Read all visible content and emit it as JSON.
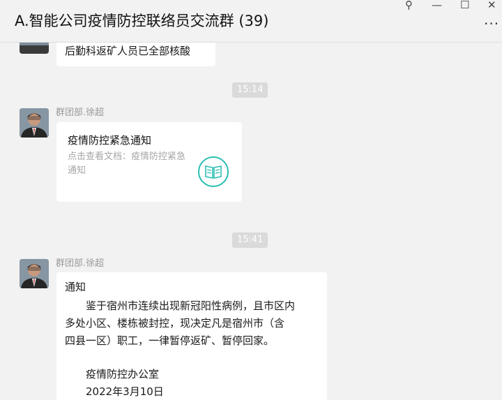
{
  "window": {
    "title": "A.智能公司疫情防控联络员交流群 (39)",
    "pin_glyph": "⚲",
    "minimize_glyph": "—",
    "maximize_glyph": "☐",
    "close_glyph": "✕",
    "more_glyph": "···"
  },
  "messages": {
    "first_bubble": "后勤科返矿人员已全部核酸",
    "time_1": "15:14",
    "sender_1": "群团部.徐超",
    "card": {
      "title": "疫情防控紧急通知",
      "subtitle": "点击查看文档：疫情防控紧急通知"
    },
    "time_2": "15:41",
    "sender_2": "群团部.徐超",
    "notice": {
      "l1": "通知",
      "l2": "鉴于宿州市连续出现新冠阳性病例，且市区内",
      "l3": "多处小区、楼栋被封控，现决定凡是宿州市（含",
      "l4": "四县一区）职工，一律暂停返矿、暂停回家。",
      "l5": "疫情防控办公室",
      "l6": "2022年3月10日"
    }
  },
  "colors": {
    "accent": "#2bbfb3",
    "background": "#f2f2f2",
    "bubble": "#ffffff"
  }
}
